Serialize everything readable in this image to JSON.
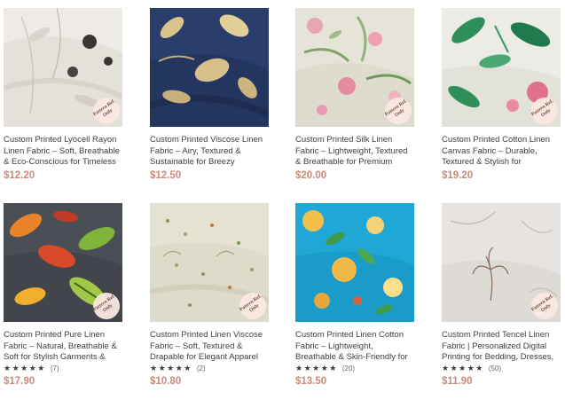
{
  "products": [
    {
      "title": "Custom Printed Lyocell Rayon Linen Fabric – Soft, Breathable & Eco-Conscious for Timeless",
      "price": "$12.20",
      "badge": "Pattern Ref. Only",
      "stars": "",
      "count": ""
    },
    {
      "title": "Custom Printed Viscose Linen Fabric – Airy, Textured & Sustainable for Breezy",
      "price": "$12.50",
      "badge": "",
      "stars": "",
      "count": ""
    },
    {
      "title": "Custom Printed Silk Linen Fabric – Lightweight, Textured & Breathable for Premium",
      "price": "$20.00",
      "badge": "Pattern Ref. Only",
      "stars": "",
      "count": ""
    },
    {
      "title": "Custom Printed Cotton Linen Canvas Fabric – Durable, Textured & Stylish for",
      "price": "$19.20",
      "badge": "Pattern Ref. Only",
      "stars": "",
      "count": ""
    },
    {
      "title": "Custom Printed Pure Linen Fabric – Natural, Breathable & Soft for Stylish Garments &",
      "price": "$17.90",
      "badge": "Pattern Ref. Only",
      "stars": "★★★★★",
      "count": "(7)"
    },
    {
      "title": "Custom Printed Linen Viscose Fabric – Soft, Textured & Drapable for Elegant Apparel",
      "price": "$10.80",
      "badge": "Pattern Ref. Only",
      "stars": "★★★★★",
      "count": "(2)"
    },
    {
      "title": "Custom Printed Linen Cotton Fabric – Lightweight, Breathable & Skin-Friendly for",
      "price": "$13.50",
      "badge": "",
      "stars": "★★★★★",
      "count": "(20)"
    },
    {
      "title": "Custom Printed Tencel Linen Fabric | Personalized Digital Printing for Bedding, Dresses,",
      "price": "$11.90",
      "badge": "Pattern Ref. Only",
      "stars": "★★★★★",
      "count": "(50)"
    }
  ]
}
